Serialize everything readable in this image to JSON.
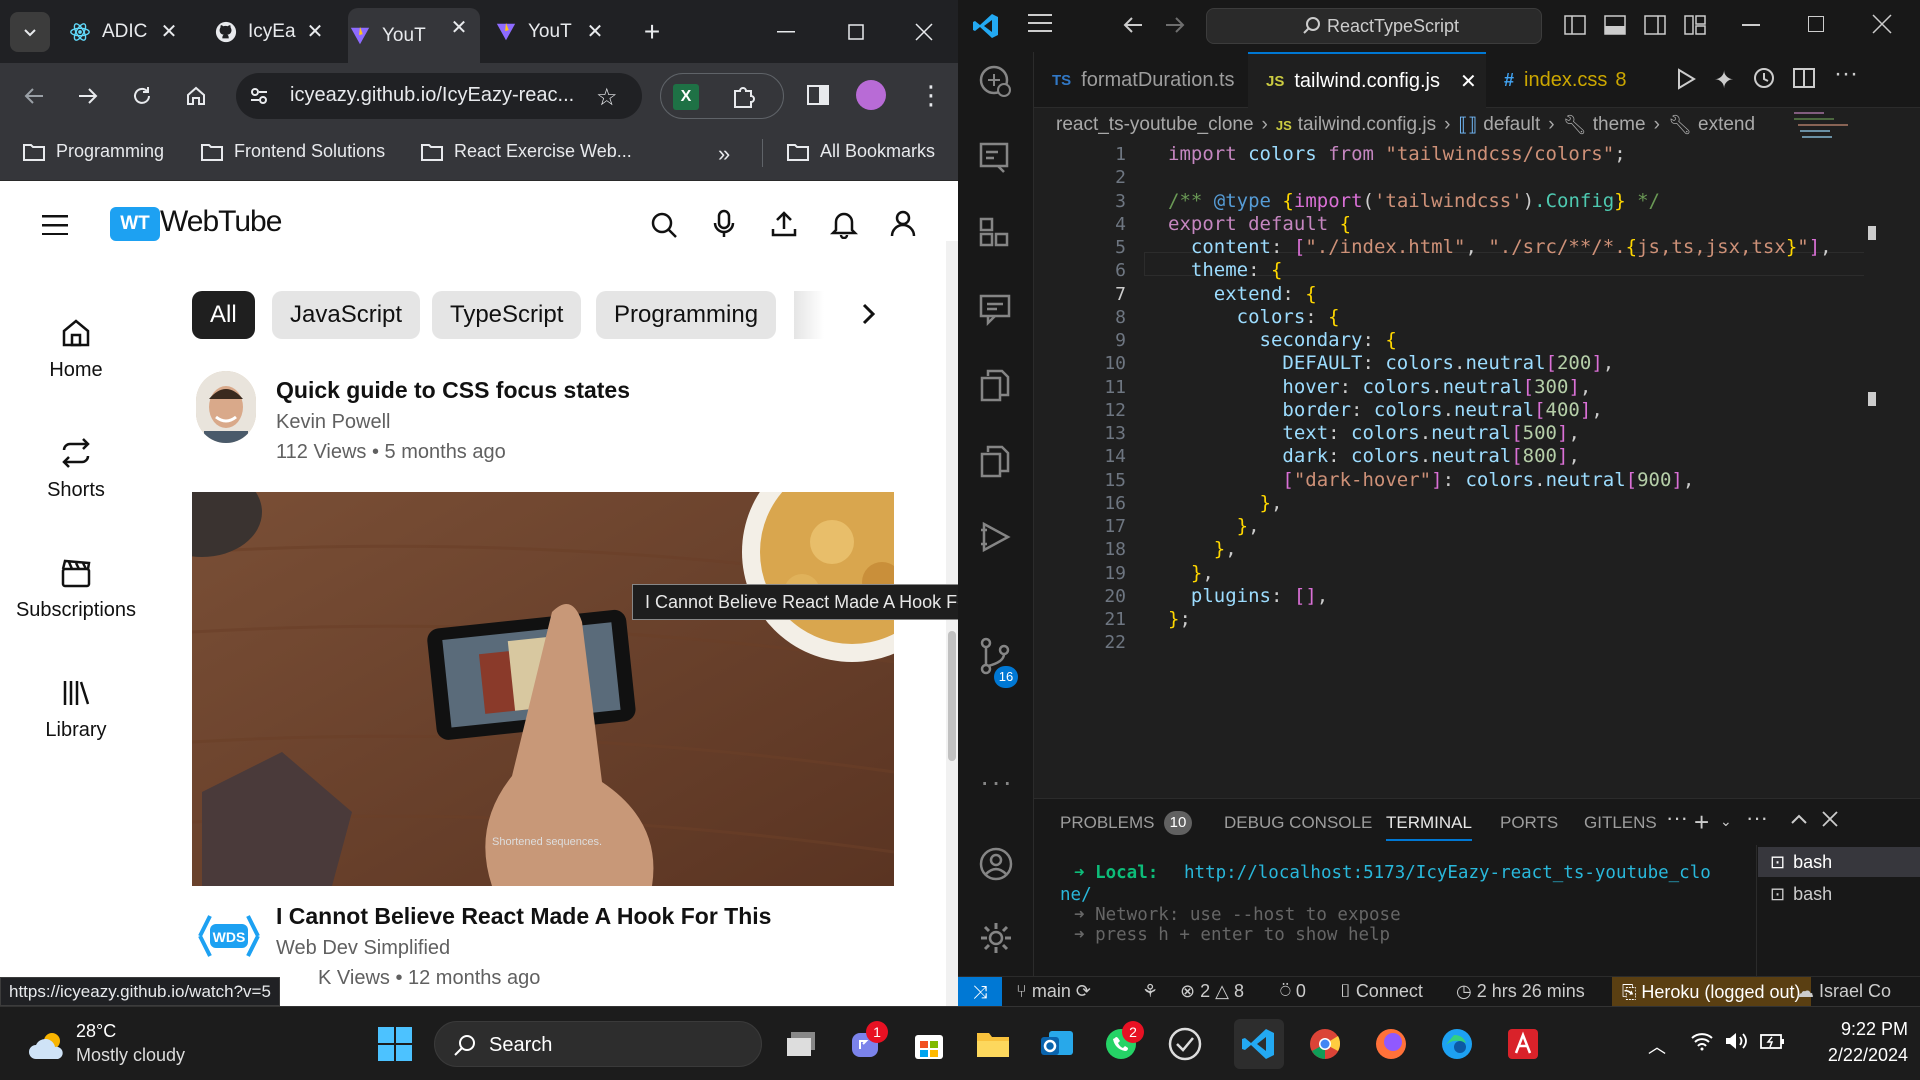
{
  "browser": {
    "tabs": [
      {
        "title": "ADIC"
      },
      {
        "title": "IcyEa"
      },
      {
        "title": "YouT"
      },
      {
        "title": "YouT"
      }
    ],
    "url": "icyeazy.github.io/IcyEazy-reac...",
    "bookmarks": [
      "Programming",
      "Frontend Solutions",
      "React Exercise Web...",
      "All Bookmarks"
    ],
    "status_url": "https://icyeazy.github.io/watch?v=5"
  },
  "webtube": {
    "logo_badge": "WT",
    "logo_text": "WebTube",
    "sidebar": [
      {
        "label": "Home",
        "icon": "home-icon"
      },
      {
        "label": "Shorts",
        "icon": "repeat-icon"
      },
      {
        "label": "Subscriptions",
        "icon": "clapperboard-icon"
      },
      {
        "label": "Library",
        "icon": "library-icon"
      }
    ],
    "chips": [
      "All",
      "JavaScript",
      "TypeScript",
      "Programming"
    ],
    "videos": [
      {
        "title": "Quick guide to CSS focus states",
        "channel": "Kevin Powell",
        "meta": "112 Views • 5 months ago"
      },
      {
        "title": "I Cannot Believe React Made A Hook For This",
        "channel": "Web Dev Simplified",
        "meta": "K Views • 12 months ago"
      }
    ],
    "thumbnail_caption": "Shortened sequences.",
    "tooltip": "I Cannot Believe React Made A Hook For This",
    "wds_badge": "WDS"
  },
  "vscode": {
    "search": "ReactTypeScript",
    "tabs": [
      {
        "lang": "TS",
        "name": "formatDuration.ts"
      },
      {
        "lang": "JS",
        "name": "tailwind.config.js"
      },
      {
        "lang": "#",
        "name": "index.css",
        "count": "8"
      }
    ],
    "breadcrumb": [
      "react_ts-youtube_clone",
      "tailwind.config.js",
      "default",
      "theme",
      "extend"
    ],
    "code_lines": [
      "import colors from \"tailwindcss/colors\";",
      "",
      "/** @type {import('tailwindcss').Config} */",
      "export default {",
      "  content: [\"./index.html\", \"./src/**/*.{js,ts,jsx,tsx}\"],",
      "  theme: {",
      "    extend: {",
      "      colors: {",
      "        secondary: {",
      "          DEFAULT: colors.neutral[200],",
      "          hover: colors.neutral[300],",
      "          border: colors.neutral[400],",
      "          text: colors.neutral[500],",
      "          dark: colors.neutral[800],",
      "          [\"dark-hover\"]: colors.neutral[900],",
      "        },",
      "      },",
      "    },",
      "  },",
      "  plugins: [],",
      "};",
      ""
    ],
    "line_numbers": [
      "1",
      "2",
      "3",
      "4",
      "5",
      "6",
      "7",
      "8",
      "9",
      "10",
      "11",
      "12",
      "13",
      "14",
      "15",
      "16",
      "17",
      "18",
      "19",
      "20",
      "21",
      "22"
    ],
    "panel": {
      "tabs": [
        "PROBLEMS",
        "DEBUG CONSOLE",
        "TERMINAL",
        "PORTS",
        "GITLENS"
      ],
      "problems_count": "10",
      "terminals": [
        "bash",
        "bash"
      ],
      "local_label": "Local:",
      "local_url": "http://localhost:5173/IcyEazy-react_ts-youtube_clo",
      "local_url_cont": "ne/",
      "network": "Network: use --host to expose",
      "help": "press h + enter to show help"
    },
    "scm_badge": "16",
    "status": {
      "branch": "main",
      "errors": "2",
      "warnings": "8",
      "ports": "0",
      "connect": "Connect",
      "time": "2 hrs 26 mins",
      "heroku": "Heroku (logged out)",
      "user": "Israel Co"
    }
  },
  "taskbar": {
    "weather_temp": "28°C",
    "weather_desc": "Mostly cloudy",
    "search": "Search",
    "badges": {
      "teams": "1",
      "whatsapp": "2"
    },
    "time": "9:22 PM",
    "date": "2/22/2024"
  }
}
